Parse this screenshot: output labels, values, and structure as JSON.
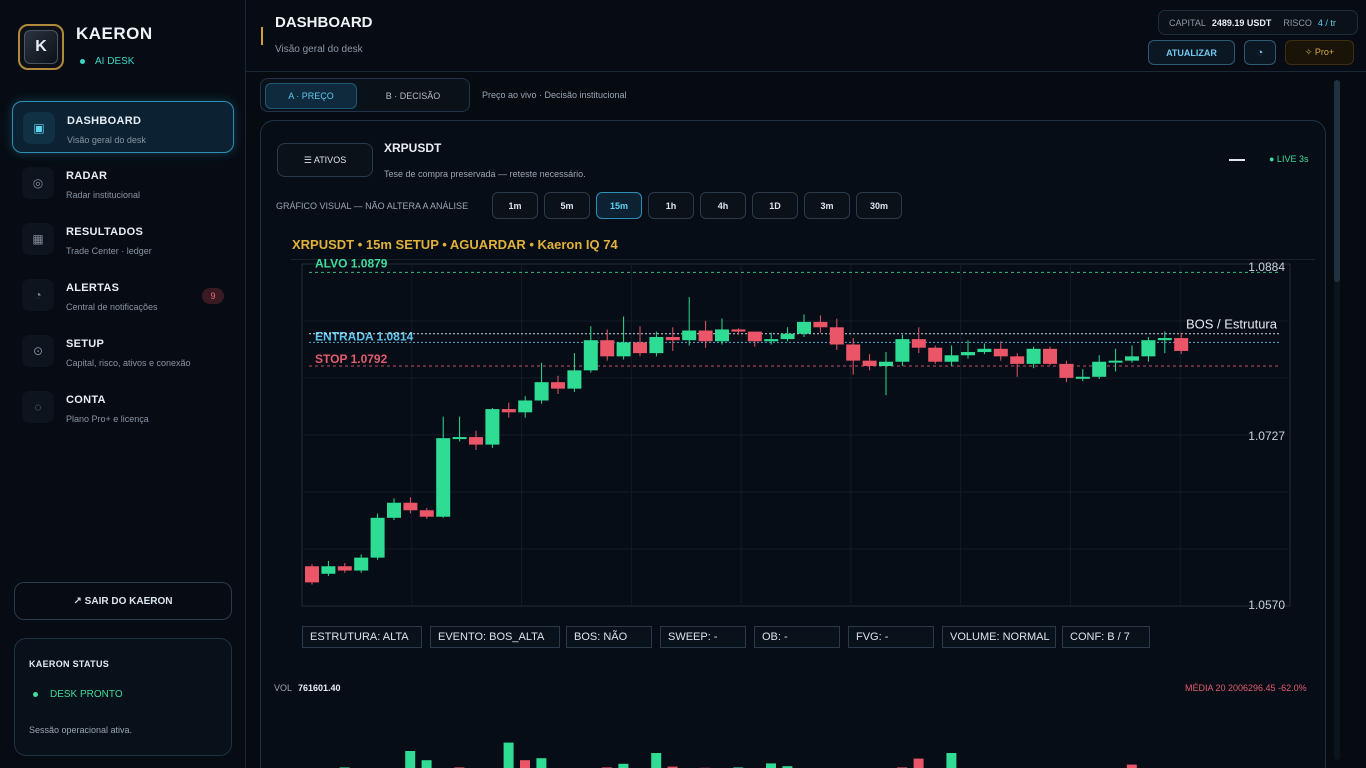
{
  "brand": {
    "title": "KAERON",
    "logo_letter": "K",
    "subtitle": "AI DESK"
  },
  "nav": [
    {
      "label": "DASHBOARD",
      "sub": "Visão geral do desk",
      "icon": "▣",
      "active": true
    },
    {
      "label": "RADAR",
      "sub": "Radar institucional",
      "icon": "◎"
    },
    {
      "label": "RESULTADOS",
      "sub": "Trade Center · ledger",
      "icon": "▦"
    },
    {
      "label": "ALERTAS",
      "sub": "Central de notificações",
      "icon": "◔",
      "badge": "9"
    },
    {
      "label": "SETUP",
      "sub": "Capital, risco, ativos e conexão",
      "icon": "⊙"
    },
    {
      "label": "CONTA",
      "sub": "Plano Pro+ e licença",
      "icon": "◌"
    }
  ],
  "logout_label": "↗ SAIR DO KAERON",
  "status": {
    "title": "KAERON STATUS",
    "state": "DESK PRONTO",
    "text": "Sessão operacional ativa."
  },
  "header": {
    "title": "DASHBOARD",
    "subtitle": "Visão geral do desk",
    "capital_label": "CAPITAL",
    "capital_value": "2489.19 USDT",
    "risk_label": "RISCO",
    "risk_value": "4 / tr",
    "refresh_label": "ATUALIZAR",
    "theme_icon": "◔",
    "plan_label": "✧ Pro+"
  },
  "tabs": {
    "a": "A · PREÇO",
    "b": "B · DECISÃO",
    "crumb": "Preço ao vivo  ·  Decisão institucional"
  },
  "asset": {
    "assets_button": "☰  ATIVOS",
    "symbol": "XRPUSDT",
    "thesis": "Tese de compra preservada — reteste necessário.",
    "live": "● LIVE 3s"
  },
  "timeframes": {
    "label": "GRÁFICO VISUAL — NÃO ALTERA A ANÁLISE",
    "options": [
      "1m",
      "5m",
      "15m",
      "1h",
      "4h",
      "1D",
      "3m",
      "30m"
    ],
    "selected": "15m"
  },
  "chart_title": "XRPUSDT  •  15m SETUP  •  AGUARDAR  •  Kaeron IQ 74",
  "chart_data": {
    "type": "candlestick",
    "y_ticks": [
      1.0884,
      1.0727,
      1.057
    ],
    "levels": [
      {
        "label": "ALVO 1.0879",
        "value": 1.0879,
        "color": "#3fdc9a"
      },
      {
        "label": "ENTRADA 1.0814",
        "value": 1.0814,
        "color": "#5fc7ef"
      },
      {
        "label": "STOP 1.0792",
        "value": 1.0792,
        "color": "#e35d6f"
      }
    ],
    "annotation": "BOS / Estrutura",
    "ylim": [
      1.057,
      1.0884
    ],
    "candles": [
      [
        1.0606,
        1.0591,
        1.0608,
        1.0589
      ],
      [
        1.0599,
        1.0606,
        1.0611,
        1.0597
      ],
      [
        1.0606,
        1.0602,
        1.0609,
        1.06
      ],
      [
        1.0602,
        1.0614,
        1.0617,
        1.06
      ],
      [
        1.0614,
        1.0651,
        1.0655,
        1.0612
      ],
      [
        1.0651,
        1.0665,
        1.0669,
        1.0649
      ],
      [
        1.0665,
        1.0658,
        1.067,
        1.0655
      ],
      [
        1.0658,
        1.0652,
        1.066,
        1.065
      ],
      [
        1.0652,
        1.0725,
        1.0745,
        1.0651
      ],
      [
        1.0725,
        1.0726,
        1.0745,
        1.0722
      ],
      [
        1.0726,
        1.0719,
        1.0732,
        1.0714
      ],
      [
        1.0719,
        1.0752,
        1.0753,
        1.0716
      ],
      [
        1.0752,
        1.0749,
        1.0758,
        1.0744
      ],
      [
        1.0749,
        1.076,
        1.0764,
        1.0744
      ],
      [
        1.076,
        1.0777,
        1.0795,
        1.0757
      ],
      [
        1.0777,
        1.0771,
        1.0783,
        1.0766
      ],
      [
        1.0771,
        1.0788,
        1.0804,
        1.0768
      ],
      [
        1.0788,
        1.0816,
        1.0829,
        1.0786
      ],
      [
        1.0816,
        1.0801,
        1.0826,
        1.0797
      ],
      [
        1.0801,
        1.0814,
        1.0838,
        1.0798
      ],
      [
        1.0814,
        1.0804,
        1.0829,
        1.0801
      ],
      [
        1.0804,
        1.0819,
        1.0824,
        1.0801
      ],
      [
        1.0819,
        1.0816,
        1.0828,
        1.0806
      ],
      [
        1.0816,
        1.0825,
        1.0856,
        1.0811
      ],
      [
        1.0825,
        1.0815,
        1.0834,
        1.0809
      ],
      [
        1.0815,
        1.0826,
        1.0836,
        1.0812
      ],
      [
        1.0826,
        1.0824,
        1.0827,
        1.0821
      ],
      [
        1.0824,
        1.0815,
        1.0819,
        1.081
      ],
      [
        1.0815,
        1.0817,
        1.0823,
        1.0812
      ],
      [
        1.0817,
        1.0822,
        1.0828,
        1.0815
      ],
      [
        1.0822,
        1.0833,
        1.084,
        1.0819
      ],
      [
        1.0833,
        1.0828,
        1.0839,
        1.0823
      ],
      [
        1.0828,
        1.0812,
        1.0836,
        1.0807
      ],
      [
        1.0812,
        1.0797,
        1.0818,
        1.0784
      ],
      [
        1.0797,
        1.0792,
        1.0803,
        1.0788
      ],
      [
        1.0792,
        1.0796,
        1.0805,
        1.0765
      ],
      [
        1.0796,
        1.0817,
        1.0821,
        1.0792
      ],
      [
        1.0817,
        1.0809,
        1.0828,
        1.0804
      ],
      [
        1.0809,
        1.0796,
        1.0811,
        1.0794
      ],
      [
        1.0796,
        1.0802,
        1.0811,
        1.0792
      ],
      [
        1.0802,
        1.0805,
        1.0816,
        1.0799
      ],
      [
        1.0805,
        1.0808,
        1.0813,
        1.0803
      ],
      [
        1.0808,
        1.0801,
        1.0815,
        1.0797
      ],
      [
        1.0801,
        1.0794,
        1.0804,
        1.0782
      ],
      [
        1.0794,
        1.0808,
        1.081,
        1.079
      ],
      [
        1.0808,
        1.0794,
        1.081,
        1.0793
      ],
      [
        1.0794,
        1.0781,
        1.0797,
        1.0777
      ],
      [
        1.0781,
        1.0782,
        1.0789,
        1.0778
      ],
      [
        1.0782,
        1.0796,
        1.0802,
        1.078
      ],
      [
        1.0796,
        1.0797,
        1.0808,
        1.0787
      ],
      [
        1.0797,
        1.0801,
        1.0811,
        1.0795
      ],
      [
        1.0801,
        1.0816,
        1.0819,
        1.0796
      ],
      [
        1.0816,
        1.0818,
        1.0824,
        1.0804
      ],
      [
        1.0818,
        1.0806,
        1.0823,
        1.0803
      ]
    ]
  },
  "tags": [
    {
      "text": "ESTRUTURA: ALTA"
    },
    {
      "text": "EVENTO: BOS_ALTA"
    },
    {
      "text": "BOS: NÃO"
    },
    {
      "text": "SWEEP: -"
    },
    {
      "text": "OB: -"
    },
    {
      "text": "FVG: -"
    },
    {
      "text": "VOLUME: NORMAL"
    },
    {
      "text": "CONF: B / 7"
    }
  ],
  "volume": {
    "label": "VOL",
    "value": "761601.40",
    "avg_label": "MÉDIA 20 2006296.45  -62.0%",
    "bars": [
      [
        0.16,
        1
      ],
      [
        0.1,
        0
      ],
      [
        0.08,
        0
      ],
      [
        0.1,
        1
      ],
      [
        0.34,
        1
      ],
      [
        0.1,
        0
      ],
      [
        0.08,
        0
      ],
      [
        0.1,
        0
      ],
      [
        0.75,
        1
      ],
      [
        0.52,
        1
      ],
      [
        0.24,
        1
      ],
      [
        0.34,
        0
      ],
      [
        0.15,
        0
      ],
      [
        0.19,
        1
      ],
      [
        0.96,
        1
      ],
      [
        0.52,
        0
      ],
      [
        0.57,
        1
      ],
      [
        0.3,
        0
      ],
      [
        0.28,
        0
      ],
      [
        0.26,
        0
      ],
      [
        0.34,
        0
      ],
      [
        0.43,
        1
      ],
      [
        0.3,
        0
      ],
      [
        0.7,
        1
      ],
      [
        0.36,
        0
      ],
      [
        0.28,
        1
      ],
      [
        0.33,
        0
      ],
      [
        0.3,
        0
      ],
      [
        0.34,
        1
      ],
      [
        0.18,
        0
      ],
      [
        0.44,
        1
      ],
      [
        0.37,
        1
      ],
      [
        0.18,
        0
      ],
      [
        0.13,
        1
      ],
      [
        0.18,
        1
      ],
      [
        0.2,
        1
      ],
      [
        0.1,
        0
      ],
      [
        0.12,
        1
      ],
      [
        0.34,
        0
      ],
      [
        0.56,
        0
      ],
      [
        0.14,
        0
      ],
      [
        0.7,
        1
      ],
      [
        0.25,
        1
      ],
      [
        0.17,
        1
      ],
      [
        0.18,
        1
      ],
      [
        0.17,
        0
      ],
      [
        0.08,
        0
      ],
      [
        0.19,
        0
      ],
      [
        0.26,
        0
      ],
      [
        0.09,
        1
      ],
      [
        0.15,
        0
      ],
      [
        0.13,
        1
      ],
      [
        0.41,
        0
      ],
      [
        0.17,
        0
      ],
      [
        0.12,
        1
      ],
      [
        0.15,
        1
      ],
      [
        0.1,
        0
      ],
      [
        0.19,
        0
      ],
      [
        0.15,
        1
      ],
      [
        0.11,
        0
      ],
      [
        0.15,
        0
      ],
      [
        0.09,
        1
      ]
    ],
    "avg_line": [
      0.12,
      0.12,
      0.14,
      0.15,
      0.16,
      0.17,
      0.17,
      0.18,
      0.2,
      0.22,
      0.23,
      0.24,
      0.24,
      0.25,
      0.26,
      0.27,
      0.27,
      0.27,
      0.27,
      0.28,
      0.28,
      0.28,
      0.28,
      0.29,
      0.28,
      0.28,
      0.27,
      0.27,
      0.27,
      0.26,
      0.26,
      0.25,
      0.25,
      0.25,
      0.24,
      0.23,
      0.22,
      0.22,
      0.21,
      0.2,
      0.2,
      0.2,
      0.19,
      0.18,
      0.18,
      0.17,
      0.17,
      0.16,
      0.15,
      0.15,
      0.14,
      0.14,
      0.14,
      0.13,
      0.13,
      0.13,
      0.12,
      0.12,
      0.12,
      0.12,
      0.11,
      0.11
    ]
  },
  "colors": {
    "bull": "#2edc93",
    "bear": "#ea5567",
    "accent": "#5fd3f0",
    "gold": "#e1b23a"
  }
}
